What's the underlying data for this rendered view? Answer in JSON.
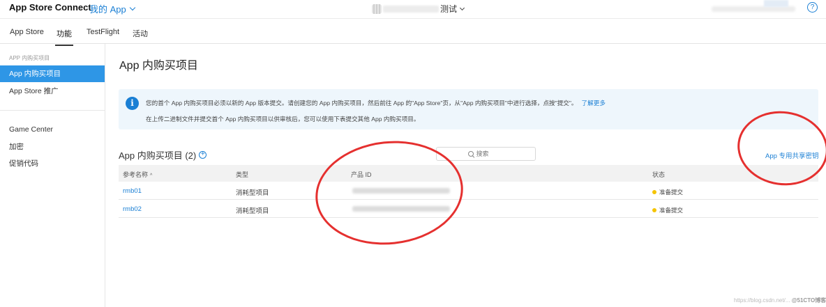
{
  "header": {
    "brand": "App Store Connect",
    "my_apps": "我的 App",
    "app_title_suffix": "测试",
    "help": "?"
  },
  "tabs": [
    {
      "label": "App Store"
    },
    {
      "label": "功能"
    },
    {
      "label": "TestFlight"
    },
    {
      "label": "活动"
    }
  ],
  "sidebar": {
    "heading": "APP 内购买项目",
    "items": [
      {
        "label": "App 内购买项目"
      },
      {
        "label": "App Store 推广"
      },
      {
        "label": "Game Center"
      },
      {
        "label": "加密"
      },
      {
        "label": "促销代码"
      }
    ]
  },
  "main": {
    "title": "App 内购买项目",
    "info": {
      "line1": "您的首个 App 内购买项目必须以新的 App 版本提交。请创建您的 App 内购买项目，然后前往 App 的\"App Store\"页，从\"App 内购买项目\"中进行选择，点按\"提交\"。",
      "link": "了解更多",
      "line2": "在上传二进制文件并提交首个 App 内购买项目以供审核后，您可以使用下表提交其他 App 内购买项目。"
    },
    "section_title": "App 内购买项目 (2)",
    "search_placeholder": "搜索",
    "shared_secret_link": "App 专用共享密钥",
    "table": {
      "headers": {
        "ref_name": "参考名称",
        "sort": "^",
        "type": "类型",
        "product_id": "产品 ID",
        "status": "状态"
      },
      "rows": [
        {
          "ref_name": "rmb01",
          "type": "消耗型项目",
          "status": "准备提交"
        },
        {
          "ref_name": "rmb02",
          "type": "消耗型项目",
          "status": "准备提交"
        }
      ]
    }
  },
  "watermark": {
    "prefix": "https://blog.csdn.net/...",
    "brand": "@51CTO博客"
  },
  "colors": {
    "accent": "#1a7fd4",
    "sidebar_active": "#2e96e6",
    "status_ready": "#f5c400",
    "annotation": "#e5302f"
  }
}
